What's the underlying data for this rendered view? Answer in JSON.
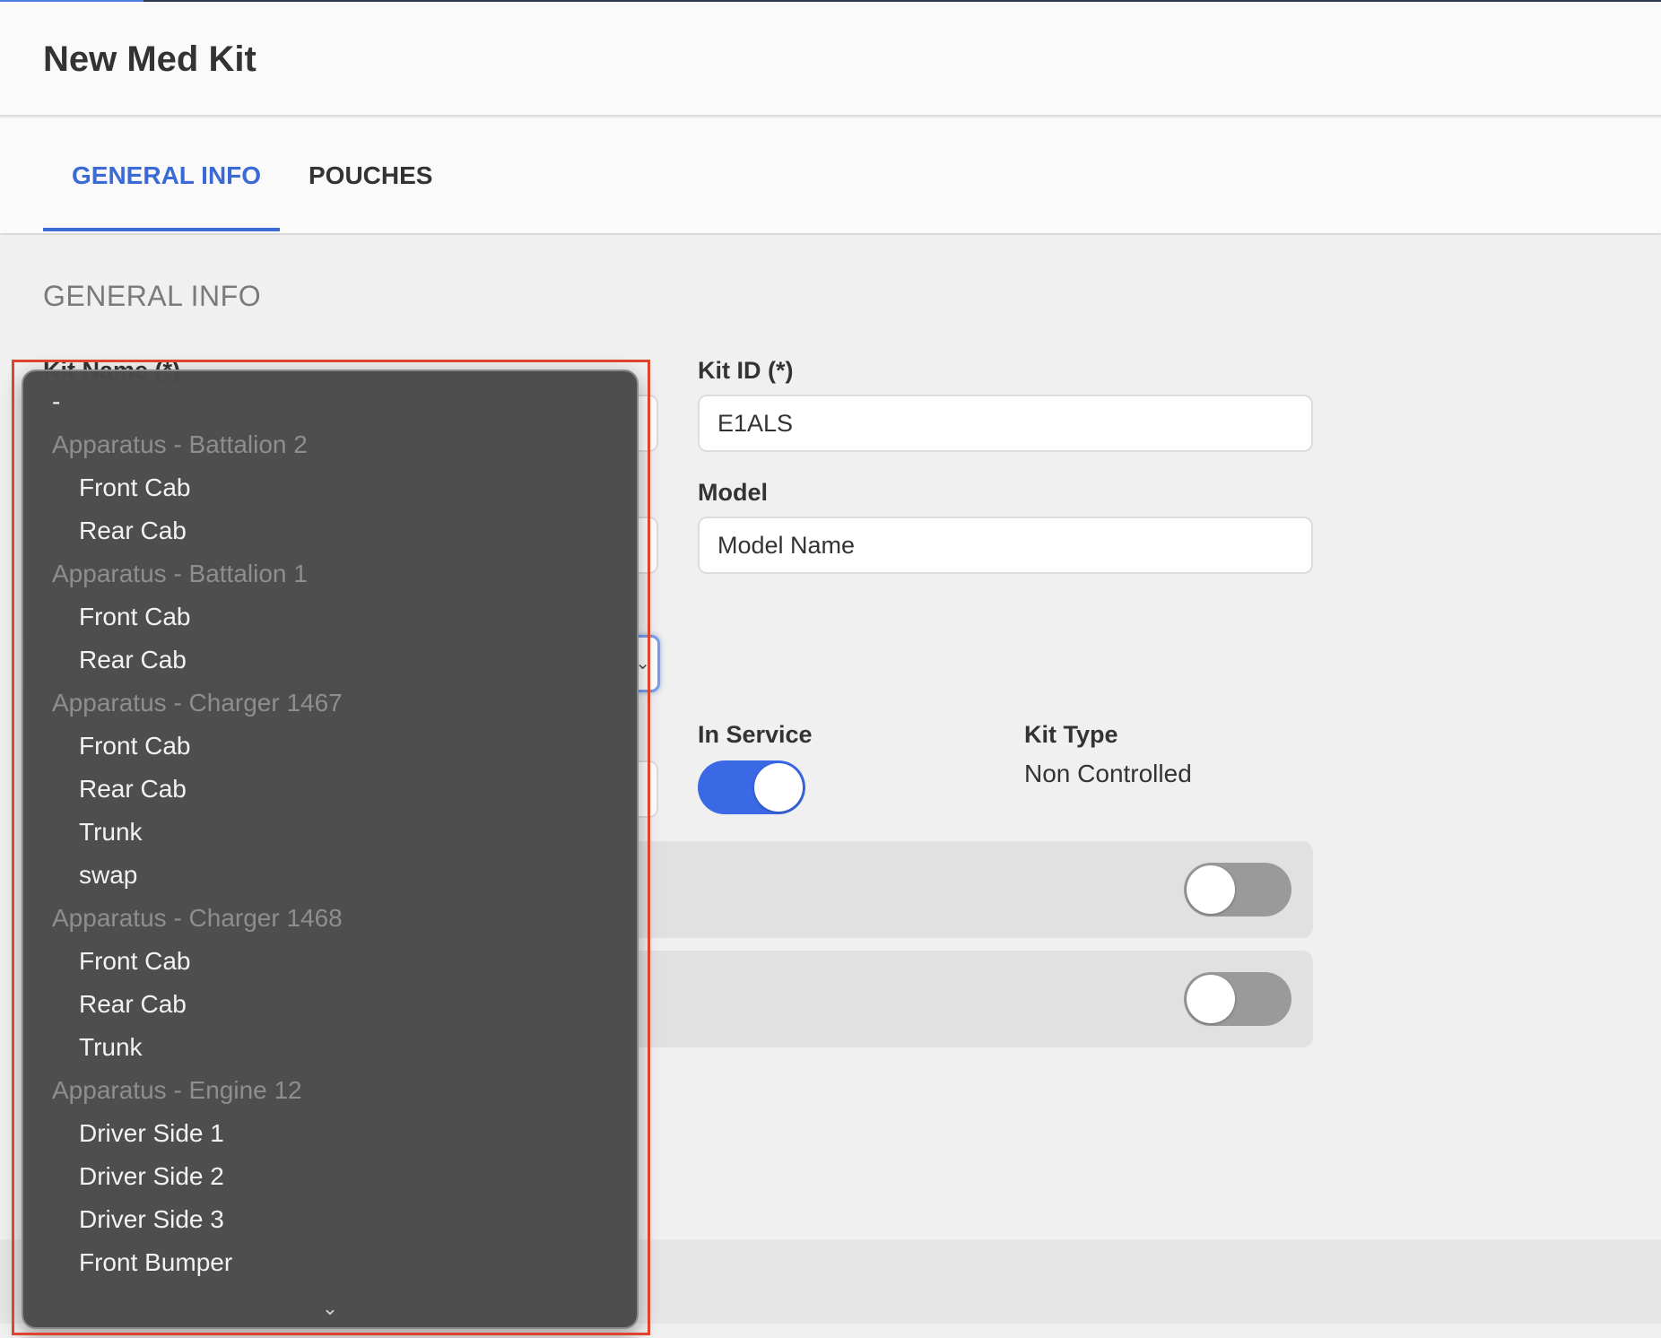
{
  "header": {
    "title": "New Med Kit"
  },
  "tabs": [
    {
      "label": "GENERAL INFO",
      "active": true
    },
    {
      "label": "POUCHES",
      "active": false
    }
  ],
  "section": {
    "title": "GENERAL INFO"
  },
  "fields": {
    "kit_name_label": "Kit Name (*)",
    "kit_id_label": "Kit ID (*)",
    "kit_id_value": "E1ALS",
    "model_label": "Model",
    "model_value": "Model Name",
    "in_service_label": "In Service",
    "kit_type_label": "Kit Type",
    "kit_type_value": "Non Controlled"
  },
  "toggles": {
    "in_service": true,
    "option_1": false,
    "option_2": false
  },
  "dropdown": {
    "items": [
      {
        "type": "option",
        "label": "-"
      },
      {
        "type": "group",
        "label": "Apparatus - Battalion 2"
      },
      {
        "type": "option",
        "label": "Front Cab"
      },
      {
        "type": "option",
        "label": "Rear Cab"
      },
      {
        "type": "group",
        "label": "Apparatus - Battalion 1"
      },
      {
        "type": "option",
        "label": "Front Cab"
      },
      {
        "type": "option",
        "label": "Rear Cab"
      },
      {
        "type": "group",
        "label": "Apparatus - Charger 1467"
      },
      {
        "type": "option",
        "label": "Front Cab"
      },
      {
        "type": "option",
        "label": "Rear Cab"
      },
      {
        "type": "option",
        "label": "Trunk"
      },
      {
        "type": "option",
        "label": "swap"
      },
      {
        "type": "group",
        "label": "Apparatus - Charger 1468"
      },
      {
        "type": "option",
        "label": "Front Cab"
      },
      {
        "type": "option",
        "label": "Rear Cab"
      },
      {
        "type": "option",
        "label": "Trunk"
      },
      {
        "type": "group",
        "label": "Apparatus - Engine 12"
      },
      {
        "type": "option",
        "label": "Driver Side 1"
      },
      {
        "type": "option",
        "label": "Driver Side 2"
      },
      {
        "type": "option",
        "label": "Driver Side 3"
      },
      {
        "type": "option",
        "label": "Front Bumper"
      }
    ],
    "more_icon": "chevron-down-icon"
  },
  "colors": {
    "accent": "#3b69d6",
    "toggle_on": "#3b69e6",
    "toggle_off": "#9a9a9a",
    "highlight": "#e0432a"
  }
}
